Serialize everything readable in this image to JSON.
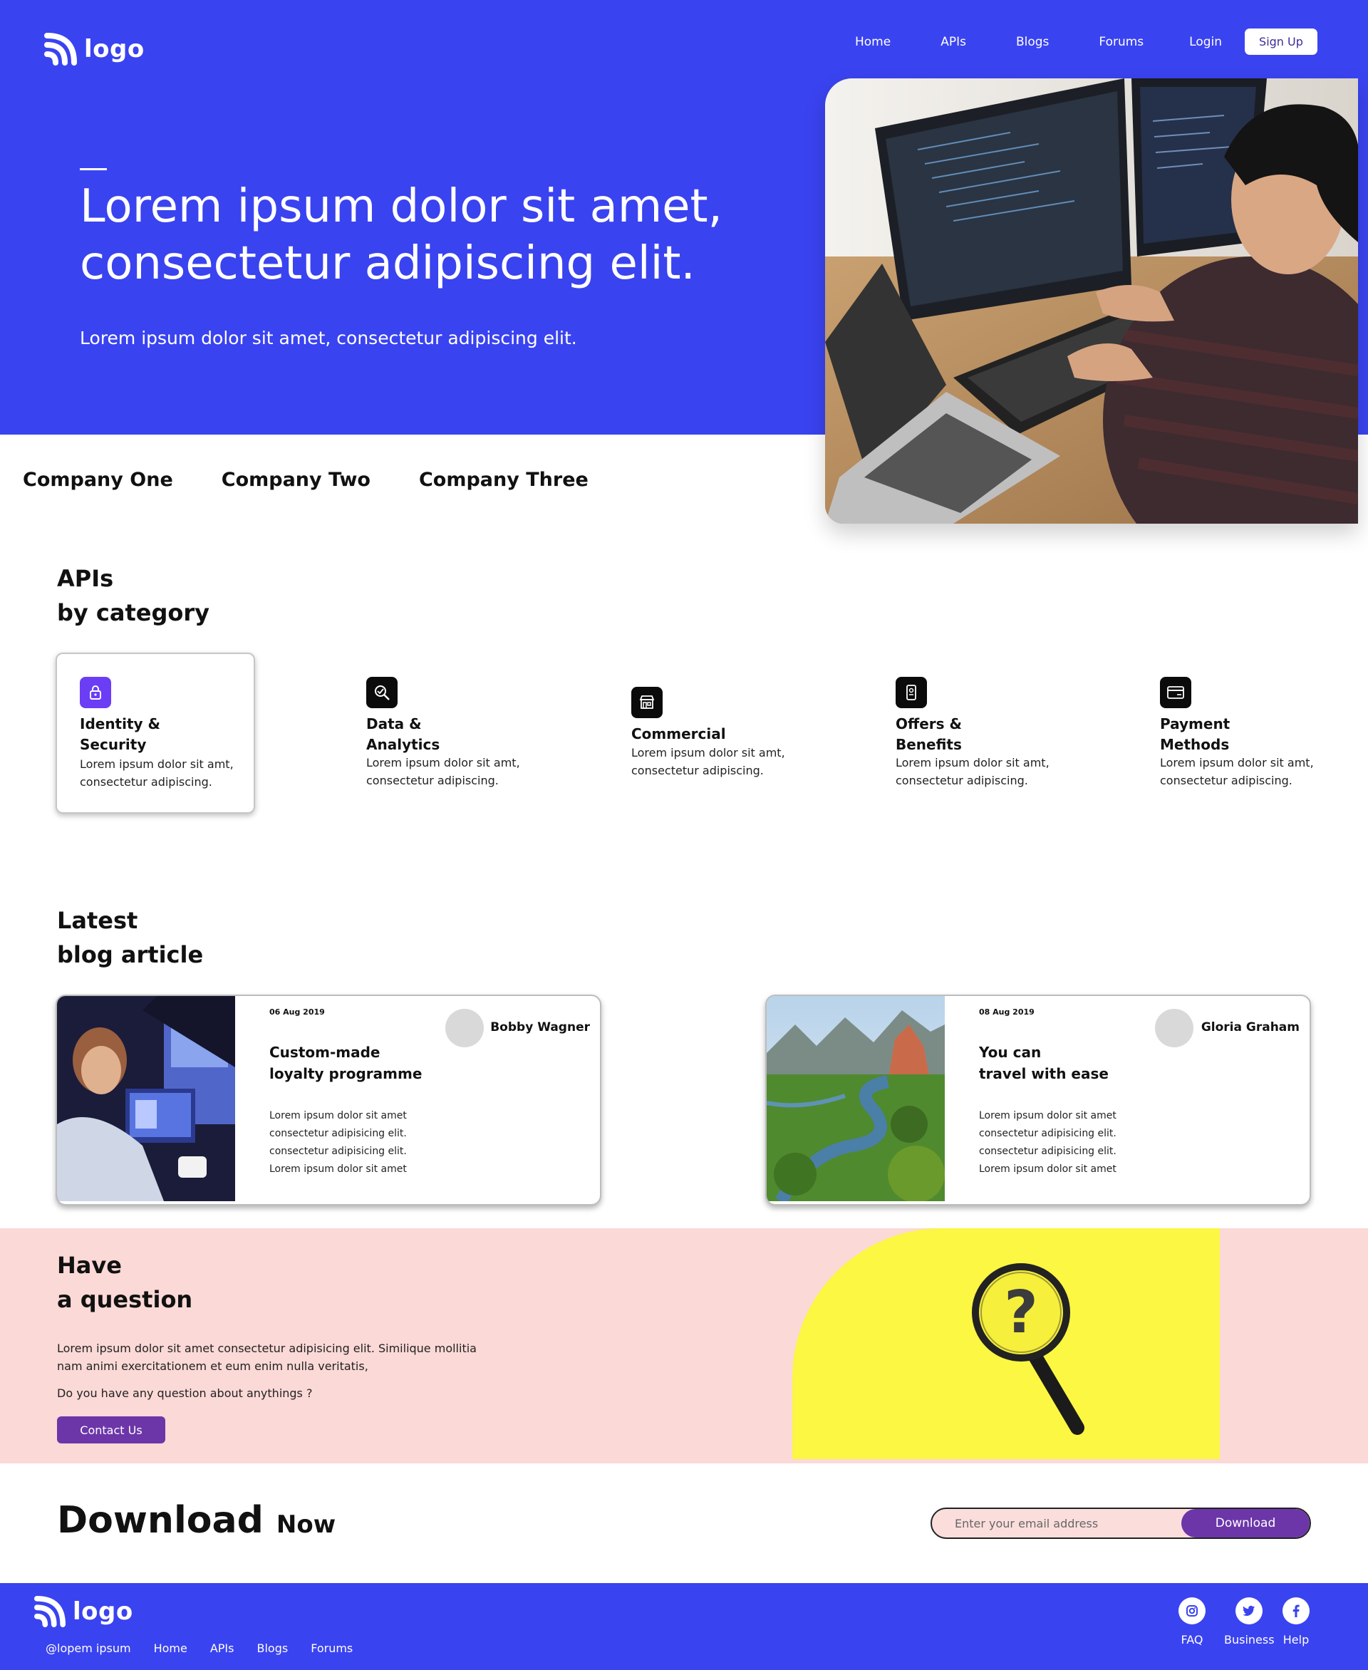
{
  "brand": {
    "logo_text": "logo",
    "primary": "#3a43f0",
    "accent": "#6c36a9",
    "pink": "#fbd9d7",
    "yellow": "#fbf742"
  },
  "nav": {
    "items": [
      "Home",
      "APIs",
      "Blogs",
      "Forums",
      "Login"
    ],
    "signup": "Sign Up"
  },
  "hero": {
    "title_line1": "Lorem ipsum dolor sit amet,",
    "title_line2": "consectetur adipiscing elit.",
    "subtitle": "Lorem ipsum dolor sit amet, consectetur adipiscing elit."
  },
  "companies": [
    "Company One",
    "Company Two",
    "Company Three"
  ],
  "apis": {
    "heading_line1": "APIs",
    "heading_line2": "by category",
    "categories": [
      {
        "title_1": "Identity &",
        "title_2": "Security",
        "desc_1": "Lorem ipsum dolor sit amt,",
        "desc_2": "consectetur adipiscing.",
        "icon": "lock-icon",
        "selected": true
      },
      {
        "title_1": "Data &",
        "title_2": "Analytics",
        "desc_1": "Lorem ipsum dolor sit amt,",
        "desc_2": "consectetur adipiscing.",
        "icon": "analytics-icon"
      },
      {
        "title_1": "Commercial",
        "title_2": "",
        "desc_1": "Lorem ipsum dolor sit amt,",
        "desc_2": "consectetur adipiscing.",
        "icon": "store-icon"
      },
      {
        "title_1": "Offers &",
        "title_2": "Benefits",
        "desc_1": "Lorem ipsum dolor sit amt,",
        "desc_2": "consectetur adipiscing.",
        "icon": "offer-icon"
      },
      {
        "title_1": "Payment",
        "title_2": "Methods",
        "desc_1": "Lorem ipsum dolor sit amt,",
        "desc_2": "consectetur adipiscing.",
        "icon": "card-icon"
      }
    ]
  },
  "blog": {
    "heading_line1": "Latest",
    "heading_line2": "blog article",
    "articles": [
      {
        "date": "06 Aug 2019",
        "author": "Bobby Wagner",
        "title_1": "Custom-made",
        "title_2": "loyalty programme",
        "text": [
          "Lorem ipsum dolor sit amet",
          "consectetur adipisicing elit.",
          "consectetur adipisicing elit.",
          "Lorem ipsum dolor sit amet"
        ]
      },
      {
        "date": "08 Aug 2019",
        "author": "Gloria Graham",
        "title_1": "You can",
        "title_2": "travel with ease",
        "text": [
          "Lorem ipsum dolor sit amet",
          "consectetur adipisicing elit.",
          "consectetur adipisicing elit.",
          "Lorem ipsum dolor sit amet"
        ]
      }
    ]
  },
  "question": {
    "heading_line1": "Have",
    "heading_line2": "a question",
    "text_1": "Lorem ipsum dolor sit amet consectetur adipisicing elit. Similique mollitia",
    "text_2": "nam animi exercitationem et eum enim nulla veritatis,",
    "ask": "Do you have any question about anythings ?",
    "button": "Contact Us"
  },
  "download": {
    "title_big": "Download",
    "title_small": "Now",
    "placeholder": "Enter your email address",
    "button": "Download"
  },
  "footer": {
    "logo_text": "logo",
    "links": [
      "@lopem ipsum",
      "Home",
      "APIs",
      "Blogs",
      "Forums"
    ],
    "social": [
      {
        "label": "FAQ",
        "icon": "instagram-icon"
      },
      {
        "label": "Business",
        "icon": "twitter-icon"
      },
      {
        "label": "Help",
        "icon": "facebook-icon"
      }
    ]
  }
}
